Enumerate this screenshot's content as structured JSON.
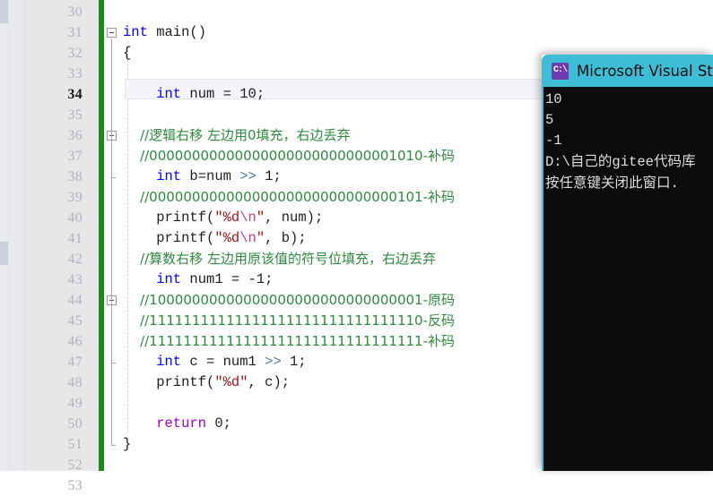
{
  "editor": {
    "name": "visual-studio-code-editor",
    "first_visible_line": 30,
    "current_line": 34,
    "line_numbers": [
      30,
      31,
      32,
      33,
      34,
      35,
      36,
      37,
      38,
      39,
      40,
      41,
      42,
      43,
      44,
      45,
      46,
      47,
      48,
      49,
      50,
      51,
      52,
      53
    ],
    "colors": {
      "background": "#ffffff",
      "gutter": "#e6e7e9",
      "change_bar_saved": "#1b8a1b",
      "keyword": "#0000ff",
      "control_keyword": "#9b00c8",
      "comment": "#2e8b3d",
      "string": "#a31515",
      "escape": "#cc3a8e",
      "operator": "#4f7f9f",
      "plain_text": "#1f1f1f",
      "current_line_fill": "#f4f5fb",
      "line_number": "#b0b3b8",
      "line_number_current": "#1c1c1c"
    },
    "lines": [
      {
        "num": 30,
        "tokens": []
      },
      {
        "num": 31,
        "tokens": [
          {
            "t": "int",
            "c": "kw"
          },
          {
            "t": " main",
            "c": "plain"
          },
          {
            "t": "()",
            "c": "brace"
          }
        ]
      },
      {
        "num": 32,
        "tokens": [
          {
            "t": "{",
            "c": "brace"
          }
        ]
      },
      {
        "num": 33,
        "tokens": []
      },
      {
        "num": 34,
        "tokens": [
          {
            "t": "    int",
            "c": "kw"
          },
          {
            "t": " num ",
            "c": "plain"
          },
          {
            "t": "=",
            "c": "plain"
          },
          {
            "t": " 10;",
            "c": "plain"
          }
        ]
      },
      {
        "num": 35,
        "tokens": []
      },
      {
        "num": 36,
        "tokens": [
          {
            "t": "    //逻辑右移 左边用0填充，右边丢弃",
            "c": "comment"
          }
        ]
      },
      {
        "num": 37,
        "tokens": [
          {
            "t": "    //00000000000000000000000000001010-补码",
            "c": "comment"
          }
        ]
      },
      {
        "num": 38,
        "tokens": [
          {
            "t": "    int",
            "c": "kw"
          },
          {
            "t": " b=num ",
            "c": "plain"
          },
          {
            "t": ">>",
            "c": "op"
          },
          {
            "t": " 1;",
            "c": "plain"
          }
        ]
      },
      {
        "num": 39,
        "tokens": [
          {
            "t": "    //00000000000000000000000000000101-补码",
            "c": "comment"
          }
        ]
      },
      {
        "num": 40,
        "tokens": [
          {
            "t": "    printf(",
            "c": "plain"
          },
          {
            "t": "\"%d",
            "c": "str"
          },
          {
            "t": "\\n",
            "c": "esc"
          },
          {
            "t": "\"",
            "c": "str"
          },
          {
            "t": ", num);",
            "c": "plain"
          }
        ]
      },
      {
        "num": 41,
        "tokens": [
          {
            "t": "    printf(",
            "c": "plain"
          },
          {
            "t": "\"%d",
            "c": "str"
          },
          {
            "t": "\\n",
            "c": "esc"
          },
          {
            "t": "\"",
            "c": "str"
          },
          {
            "t": ", b);",
            "c": "plain"
          }
        ]
      },
      {
        "num": 42,
        "tokens": [
          {
            "t": "    //算数右移 左边用原该值的符号位填充，右边丢弃",
            "c": "comment"
          }
        ]
      },
      {
        "num": 43,
        "tokens": [
          {
            "t": "    int",
            "c": "kw"
          },
          {
            "t": " num1 = -1;",
            "c": "plain"
          }
        ]
      },
      {
        "num": 44,
        "tokens": [
          {
            "t": "    //10000000000000000000000000000001-原码",
            "c": "comment"
          }
        ]
      },
      {
        "num": 45,
        "tokens": [
          {
            "t": "    //11111111111111111111111111111110-反码",
            "c": "comment"
          }
        ]
      },
      {
        "num": 46,
        "tokens": [
          {
            "t": "    //11111111111111111111111111111111-补码",
            "c": "comment"
          }
        ]
      },
      {
        "num": 47,
        "tokens": [
          {
            "t": "    int",
            "c": "kw"
          },
          {
            "t": " c = num1 ",
            "c": "plain"
          },
          {
            "t": ">>",
            "c": "op"
          },
          {
            "t": " 1;",
            "c": "plain"
          }
        ]
      },
      {
        "num": 48,
        "tokens": [
          {
            "t": "    printf(",
            "c": "plain"
          },
          {
            "t": "\"%d\"",
            "c": "str"
          },
          {
            "t": ", c);",
            "c": "plain"
          }
        ]
      },
      {
        "num": 49,
        "tokens": []
      },
      {
        "num": 50,
        "tokens": [
          {
            "t": "    return",
            "c": "ctrl"
          },
          {
            "t": " 0;",
            "c": "plain"
          }
        ]
      },
      {
        "num": 51,
        "tokens": [
          {
            "t": "}",
            "c": "brace"
          }
        ]
      },
      {
        "num": 52,
        "tokens": []
      },
      {
        "num": 53,
        "tokens": []
      }
    ],
    "fold_markers": [
      {
        "line": 31,
        "state": "expanded"
      },
      {
        "line": 36,
        "state": "expanded"
      },
      {
        "line": 44,
        "state": "expanded"
      }
    ]
  },
  "console": {
    "name": "microsoft-visual-studio-console",
    "title": "Microsoft Visual Studio",
    "icon": "console-window-icon",
    "titlebar_color": "#3dbdd6",
    "background_color": "#0c0c0c",
    "text_color": "#dfdfdf",
    "output_lines": [
      "10",
      "5",
      "-1",
      "D:\\自己的gitee代码库",
      "按任意键关闭此窗口."
    ]
  }
}
